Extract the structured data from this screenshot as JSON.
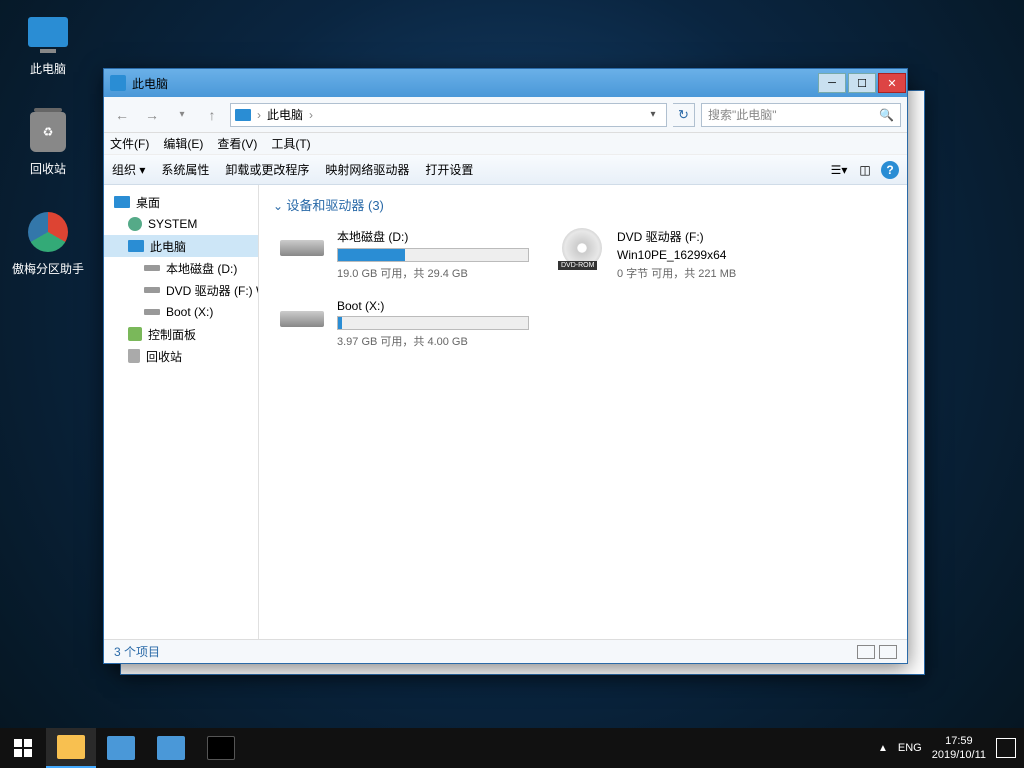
{
  "desktop_icons": {
    "this_pc": "此电脑",
    "recycle_bin": "回收站",
    "aomei": "傲梅分区助手"
  },
  "window": {
    "title": "此电脑",
    "nav": {
      "back": "←",
      "forward": "→",
      "up": "↑",
      "address_label": "此电脑",
      "address_sep": "›",
      "search_placeholder": "搜索\"此电脑\""
    },
    "menu": {
      "file": "文件(F)",
      "edit": "编辑(E)",
      "view": "查看(V)",
      "tools": "工具(T)"
    },
    "toolbar": {
      "organize": "组织 ▾",
      "sys_props": "系统属性",
      "uninstall": "卸载或更改程序",
      "map_drive": "映射网络驱动器",
      "open_settings": "打开设置"
    },
    "tree": {
      "desktop": "桌面",
      "system_user": "SYSTEM",
      "this_pc": "此电脑",
      "local_disk_d": "本地磁盘 (D:)",
      "dvd_f": "DVD 驱动器 (F:) W",
      "boot_x": "Boot (X:)",
      "control_panel": "控制面板",
      "recycle_bin": "回收站"
    },
    "content": {
      "group_header": "设备和驱动器 (3)",
      "drives": [
        {
          "name": "本地磁盘 (D:)",
          "text": "19.0 GB 可用，共 29.4 GB",
          "fill_pct": 35,
          "type": "hdd"
        },
        {
          "name": "DVD 驱动器 (F:)",
          "sub": "Win10PE_16299x64",
          "text": "0 字节 可用，共 221 MB",
          "type": "dvd"
        },
        {
          "name": "Boot (X:)",
          "text": "3.97 GB 可用，共 4.00 GB",
          "fill_pct": 2,
          "type": "hdd"
        }
      ]
    },
    "status": {
      "text": "3 个项目"
    }
  },
  "taskbar": {
    "lang": "ENG",
    "time": "17:59",
    "date": "2019/10/11"
  }
}
